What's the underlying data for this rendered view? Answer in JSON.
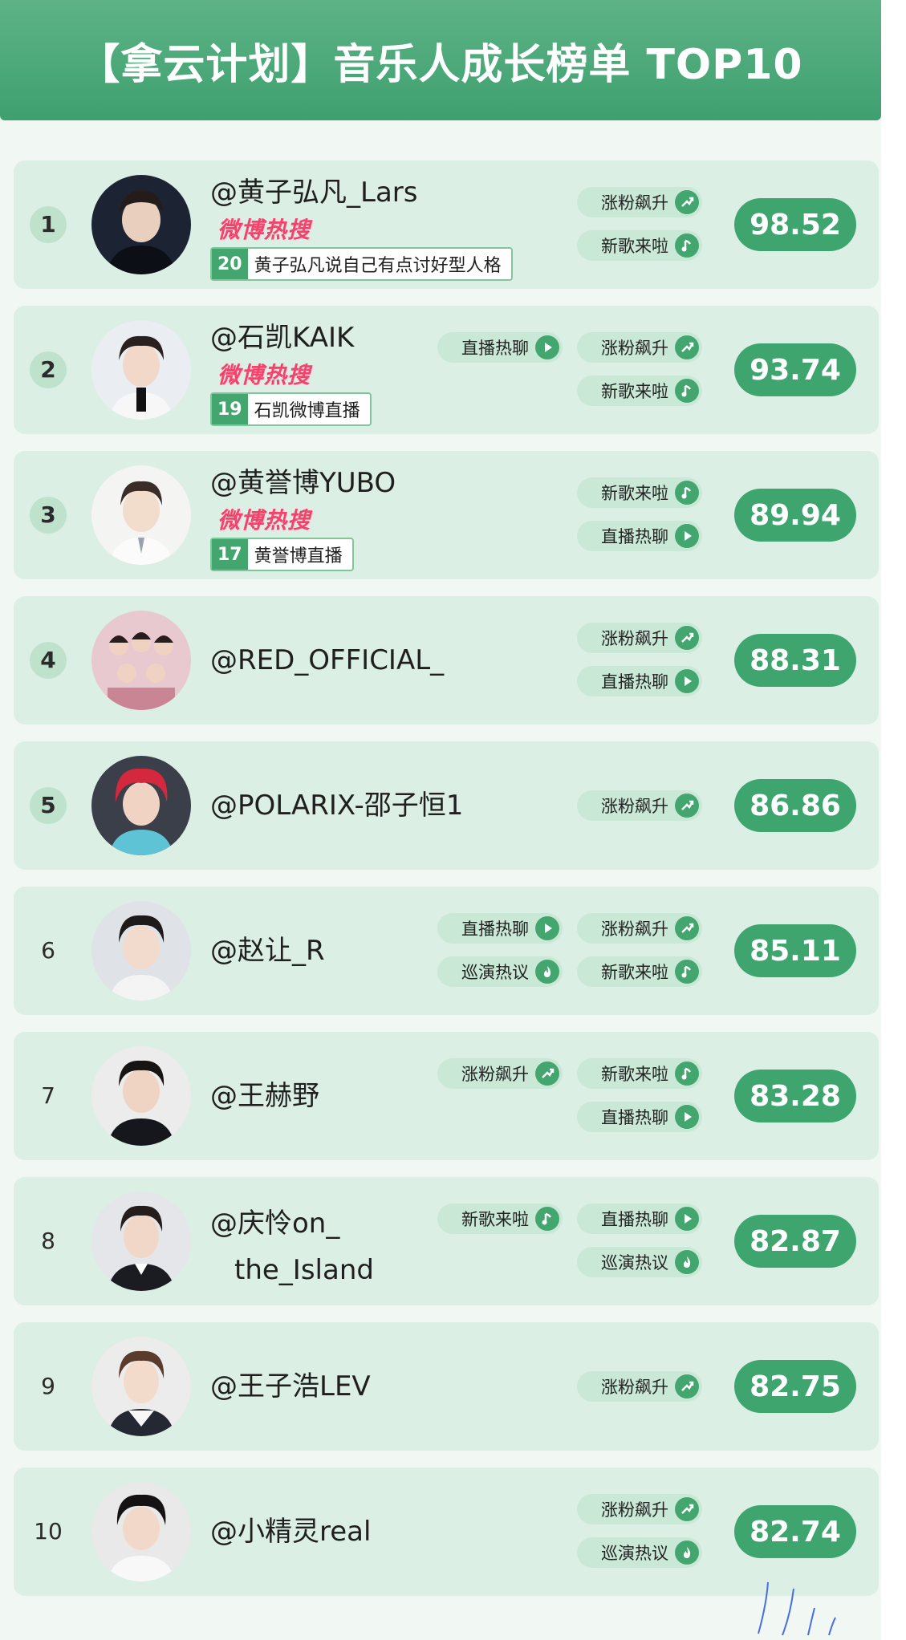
{
  "title": "【拿云计划】音乐人成长榜单 TOP10",
  "weibo_logo_text": "微博热搜",
  "colors": {
    "header": "#4aa877",
    "row_bg": "#dcefe4",
    "score_pill": "#3ea56f",
    "tag_bg": "#c9e8d5",
    "tag_icon": "#43a66f",
    "hot_logo": "#f2436b"
  },
  "rows": [
    {
      "rank": "1",
      "name": "@黄子弘凡_Lars",
      "score": "98.52",
      "hot": {
        "rank": "20",
        "text": "黄子弘凡说自己有点讨好型人格"
      },
      "tags": [
        {
          "label": "涨粉飙升",
          "icon": "rise-icon"
        },
        {
          "label": "新歌来啦",
          "icon": "music-note-icon"
        }
      ]
    },
    {
      "rank": "2",
      "name": "@石凯KAIK",
      "score": "93.74",
      "hot": {
        "rank": "19",
        "text": "石凯微博直播"
      },
      "tags": [
        {
          "label": "直播热聊",
          "icon": "play-icon"
        },
        {
          "label": "涨粉飙升",
          "icon": "rise-icon"
        },
        {
          "label": "新歌来啦",
          "icon": "music-note-icon"
        }
      ]
    },
    {
      "rank": "3",
      "name": "@黄誉博YUBO",
      "score": "89.94",
      "hot": {
        "rank": "17",
        "text": "黄誉博直播"
      },
      "tags": [
        {
          "label": "新歌来啦",
          "icon": "music-note-icon"
        },
        {
          "label": "直播热聊",
          "icon": "play-icon"
        }
      ]
    },
    {
      "rank": "4",
      "name": "@RED_OFFICIAL_",
      "score": "88.31",
      "tags": [
        {
          "label": "涨粉飙升",
          "icon": "rise-icon"
        },
        {
          "label": "直播热聊",
          "icon": "play-icon"
        }
      ]
    },
    {
      "rank": "5",
      "name": "@POLARIX-邵子恒1",
      "score": "86.86",
      "tags": [
        {
          "label": "涨粉飙升",
          "icon": "rise-icon"
        }
      ]
    },
    {
      "rank": "6",
      "name": "@赵让_R",
      "score": "85.11",
      "tags": [
        {
          "label": "直播热聊",
          "icon": "play-icon"
        },
        {
          "label": "巡演热议",
          "icon": "flame-icon"
        },
        {
          "label": "涨粉飙升",
          "icon": "rise-icon"
        },
        {
          "label": "新歌来啦",
          "icon": "music-note-icon"
        }
      ]
    },
    {
      "rank": "7",
      "name": "@王赫野",
      "score": "83.28",
      "tags": [
        {
          "label": "涨粉飙升",
          "icon": "rise-icon"
        },
        {
          "label": "新歌来啦",
          "icon": "music-note-icon"
        },
        {
          "label": "直播热聊",
          "icon": "play-icon"
        }
      ]
    },
    {
      "rank": "8",
      "name": "@庆怜on_",
      "name_line2": "the_Island",
      "score": "82.87",
      "tags": [
        {
          "label": "新歌来啦",
          "icon": "music-note-icon"
        },
        {
          "label": "直播热聊",
          "icon": "play-icon"
        },
        {
          "label": "巡演热议",
          "icon": "flame-icon"
        }
      ]
    },
    {
      "rank": "9",
      "name": "@王子浩LEV",
      "score": "82.75",
      "tags": [
        {
          "label": "涨粉飙升",
          "icon": "rise-icon"
        }
      ]
    },
    {
      "rank": "10",
      "name": "@小精灵real",
      "score": "82.74",
      "tags": [
        {
          "label": "涨粉飙升",
          "icon": "rise-icon"
        },
        {
          "label": "巡演热议",
          "icon": "flame-icon"
        }
      ]
    }
  ]
}
